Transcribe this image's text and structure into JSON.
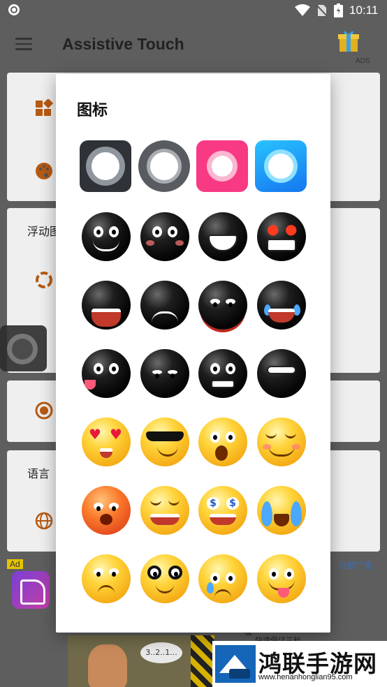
{
  "status_bar": {
    "time": "10:11"
  },
  "app_bar": {
    "title": "Assistive Touch",
    "ads_label": "ADS"
  },
  "background": {
    "section_floating_label": "浮动图",
    "section_language_label": "语言",
    "ad_badge": "Ad",
    "google_ad_label": "谷歌广告",
    "banner_bubble": "3..2..1...",
    "banner_text_1": "极",
    "banner_text_2": "快速保证三秒"
  },
  "dialog": {
    "title": "图标",
    "style_icons": [
      {
        "name": "style-dark-square-icon"
      },
      {
        "name": "style-gray-circle-icon"
      },
      {
        "name": "style-pink-square-icon"
      },
      {
        "name": "style-blue-square-icon"
      }
    ],
    "emoji_rows": [
      [
        "black-crazy-smile",
        "black-worried",
        "black-grin-peace",
        "black-angry-red-eyes"
      ],
      [
        "black-screaming",
        "black-frown",
        "black-devil-angry",
        "black-crying"
      ],
      [
        "black-tongue-out",
        "black-smirk-sunglasses",
        "black-shocked",
        "black-laughing-tears"
      ],
      [
        "yellow-heart-eyes",
        "yellow-cool-sunglasses",
        "yellow-surprised",
        "yellow-content-smile"
      ],
      [
        "red-angry-shout",
        "yellow-smug",
        "yellow-dollar-eyes",
        "yellow-crying-loud"
      ],
      [
        "yellow-eye-roll",
        "yellow-nerd-glasses",
        "yellow-sad-tears",
        "yellow-tongue-out"
      ]
    ]
  },
  "watermark": {
    "title": "鸿联手游网",
    "url": "www.henanhonglian95.com"
  }
}
